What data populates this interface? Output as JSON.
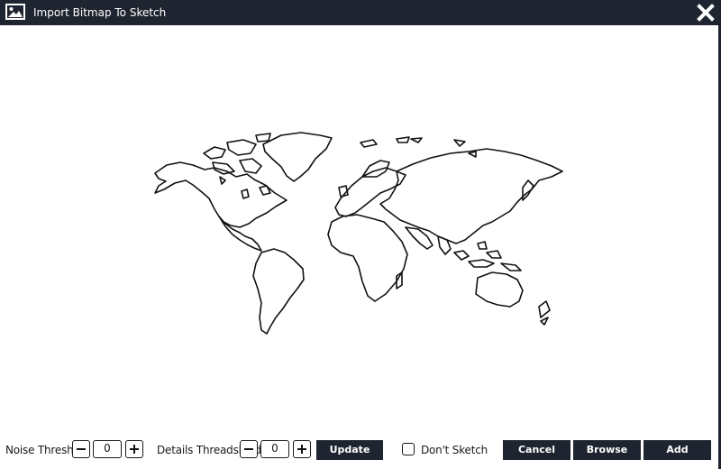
{
  "window": {
    "title": "Import Bitmap To Sketch",
    "title_icon": "image-icon",
    "close_icon": "close-icon"
  },
  "toolbar": {
    "noise_threshold": {
      "label": "Noise Threshold",
      "value": "0"
    },
    "details_threshold": {
      "label": "Details Threadshold",
      "value": "0"
    },
    "update_label": "Update",
    "dont_sketch": {
      "label": "Don't Sketch",
      "checked": false
    },
    "cancel_label": "Cancel",
    "browse_label": "Browse",
    "add_label": "Add"
  },
  "colors": {
    "titlebar": "#1f2530",
    "button_bg": "#1f2530",
    "outline": "#111111"
  }
}
